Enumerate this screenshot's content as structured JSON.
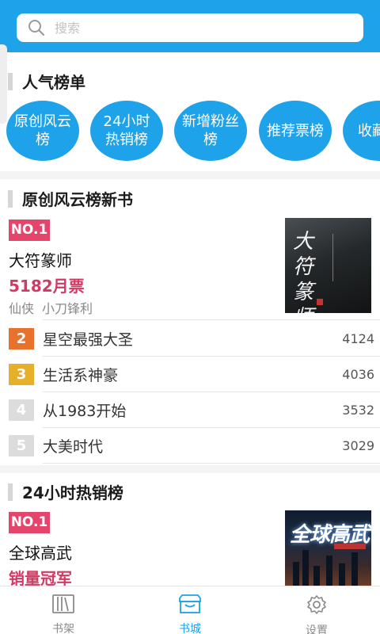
{
  "search": {
    "placeholder": "搜索"
  },
  "popular": {
    "title": "人气榜单",
    "bubbles": [
      "原创风云榜",
      "24小时热销榜",
      "新增粉丝榜",
      "推荐票榜",
      "收藏榜"
    ]
  },
  "section1": {
    "title": "原创风云榜新书",
    "top": {
      "badge": "NO.1",
      "title": "大符篆师",
      "stat": "5182月票",
      "genre": "仙侠",
      "author": "小刀锋利",
      "cover_title": "大符篆师"
    },
    "ranks": [
      {
        "num": "2",
        "name": "星空最强大圣",
        "value": "4124",
        "color": "#e8712b"
      },
      {
        "num": "3",
        "name": "生活系神豪",
        "value": "4036",
        "color": "#e6b02a"
      },
      {
        "num": "4",
        "name": "从1983开始",
        "value": "3532",
        "color": "#dcdcdc"
      },
      {
        "num": "5",
        "name": "大美时代",
        "value": "3029",
        "color": "#dcdcdc"
      }
    ]
  },
  "section2": {
    "title": "24小时热销榜",
    "top": {
      "badge": "NO.1",
      "title": "全球高武",
      "stat": "销量冠军",
      "cover_title": "全球高武"
    }
  },
  "tabs": [
    {
      "label": "书架",
      "icon": "bookshelf-icon",
      "active": false
    },
    {
      "label": "书城",
      "icon": "bookstore-icon",
      "active": true
    },
    {
      "label": "设置",
      "icon": "settings-gear-icon",
      "active": false
    }
  ],
  "colors": {
    "accent": "#1ea2ea",
    "badge": "#e5456a",
    "stat": "#d23a63"
  }
}
